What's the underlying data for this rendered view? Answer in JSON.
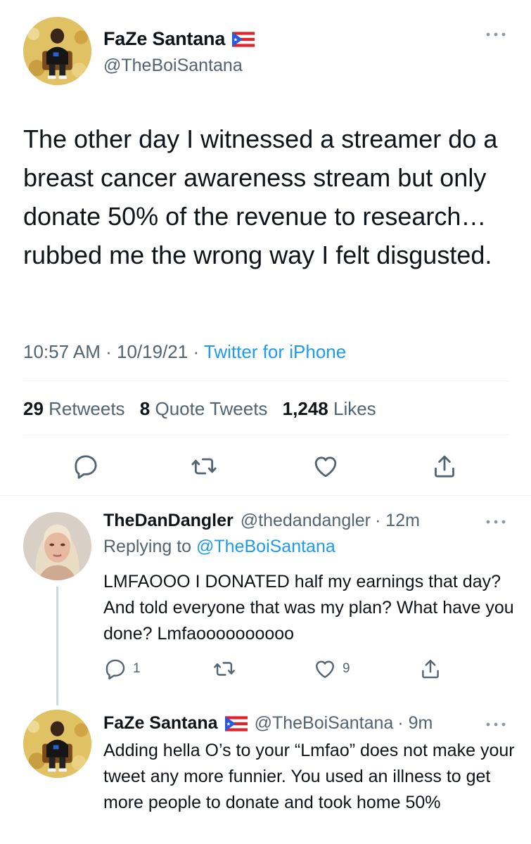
{
  "main_tweet": {
    "display_name": "FaZe Santana",
    "handle": "@TheBoiSantana",
    "text": "The other day I witnessed a streamer do a breast cancer awareness stream but only donate 50% of the revenue to research… rubbed me the wrong way I felt disgusted.",
    "time": "10:57 AM",
    "date": "10/19/21",
    "separator": "·",
    "source": "Twitter for iPhone",
    "stats": {
      "retweets_count": "29",
      "retweets_label": "Retweets",
      "quotes_count": "8",
      "quotes_label": "Quote Tweets",
      "likes_count": "1,248",
      "likes_label": "Likes"
    },
    "actions": [
      "reply-icon",
      "retweet-icon",
      "like-icon",
      "share-icon"
    ]
  },
  "replies": [
    {
      "display_name": "TheDanDangler",
      "handle": "@thedandangler",
      "age": "· 12m",
      "replying_prefix": "Replying to",
      "replying_to": "@TheBoiSantana",
      "text": "LMFAOOO I DONATED half my earnings that day? And told everyone that was my plan? What have you done? Lmfaoooooooooo",
      "reply_count": "1",
      "like_count": "9"
    },
    {
      "display_name": "FaZe Santana",
      "handle": "@TheBoiSantana",
      "age": "· 9m",
      "text": "Adding hella O’s to your “Lmfao” does not make your tweet any more funnier. You used an illness to get more people to donate and took home 50%"
    }
  ],
  "colors": {
    "accent": "#1d9bf0",
    "secondary_text": "#536471",
    "primary_text": "#0f1419",
    "divider": "#eff3f4"
  }
}
